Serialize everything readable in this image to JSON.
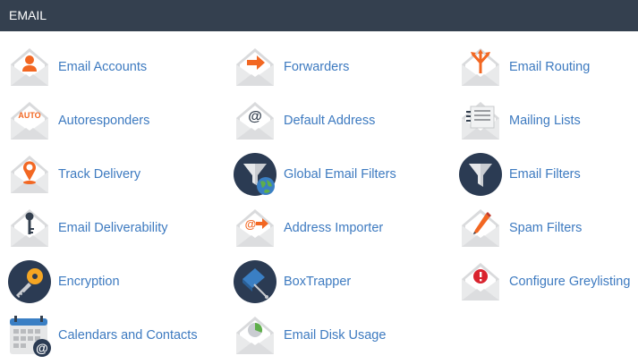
{
  "section_title": "EMAIL",
  "items": {
    "email_accounts": "Email Accounts",
    "forwarders": "Forwarders",
    "email_routing": "Email Routing",
    "autoresponders": "Autoresponders",
    "default_address": "Default Address",
    "mailing_lists": "Mailing Lists",
    "track_delivery": "Track Delivery",
    "global_email_filters": "Global Email Filters",
    "email_filters": "Email Filters",
    "email_deliverability": "Email Deliverability",
    "address_importer": "Address Importer",
    "spam_filters": "Spam Filters",
    "encryption": "Encryption",
    "boxtrapper": "BoxTrapper",
    "configure_greylisting": "Configure Greylisting",
    "calendars_and_contacts": "Calendars and Contacts",
    "email_disk_usage": "Email Disk Usage"
  },
  "icon_text": {
    "autoresponders": "AUTO",
    "default_address": "@",
    "address_importer": "@",
    "calendars": "@"
  },
  "colors": {
    "header_bg": "#34404f",
    "link": "#3d7ac0",
    "accent_orange": "#f26722",
    "envelope": "#e6e7e8",
    "dark_circle": "#2b3b53",
    "alert_red": "#d9232e"
  }
}
